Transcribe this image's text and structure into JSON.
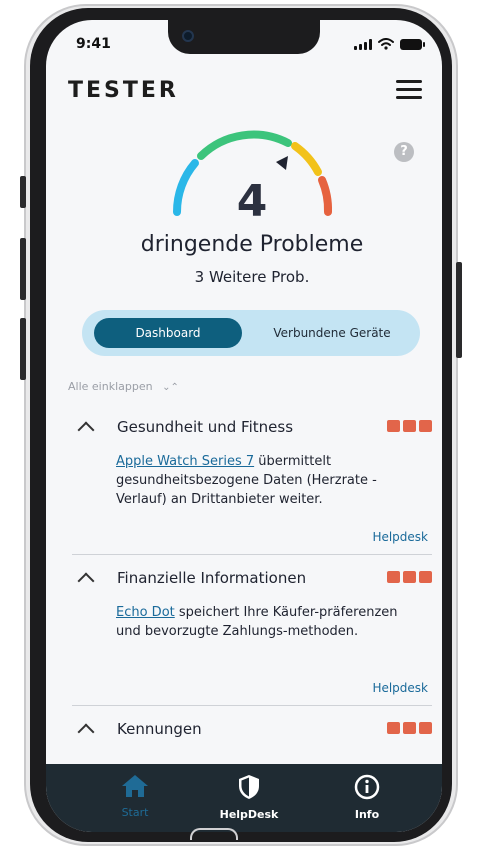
{
  "status_bar": {
    "time": "9:41"
  },
  "header": {
    "title": "TESTER",
    "menu_icon": "hamburger-menu-icon"
  },
  "gauge": {
    "count": "4",
    "label": "dringende Probleme",
    "subtitle": "3 Weitere Prob.",
    "help_icon": "?",
    "colors": [
      "#2ab7e8",
      "#3cc47c",
      "#f2c21a",
      "#e6623f"
    ]
  },
  "tabs": [
    {
      "label": "Dashboard",
      "active": true
    },
    {
      "label": "Verbundene Geräte",
      "active": false
    }
  ],
  "collapse_all": {
    "label": "Alle einklappen",
    "icon": "chevrons-collapse-icon"
  },
  "issues": [
    {
      "title": "Gesundheit und Fitness",
      "device": "Apple Watch Series 7",
      "text": " übermittelt gesundheitsbezogene Daten (Herzrate - Verlauf) an Drittanbieter weiter.",
      "helpdesk": "Helpdesk",
      "severity_color": "#e2654a"
    },
    {
      "title": "Finanzielle Informationen",
      "device": "Echo Dot",
      "text": " speichert Ihre Käufer-präferenzen und bevorzugte Zahlungs-methoden.",
      "helpdesk": "Helpdesk",
      "severity_color": "#e2654a"
    },
    {
      "title": "Kennungen",
      "severity_color": "#e2654a"
    }
  ],
  "bottom_nav": [
    {
      "label": "Start",
      "icon": "home-icon",
      "active": true,
      "color": "#1f6b96"
    },
    {
      "label": "HelpDesk",
      "icon": "shield-icon",
      "active": false
    },
    {
      "label": "Info",
      "icon": "info-icon",
      "active": false
    }
  ]
}
